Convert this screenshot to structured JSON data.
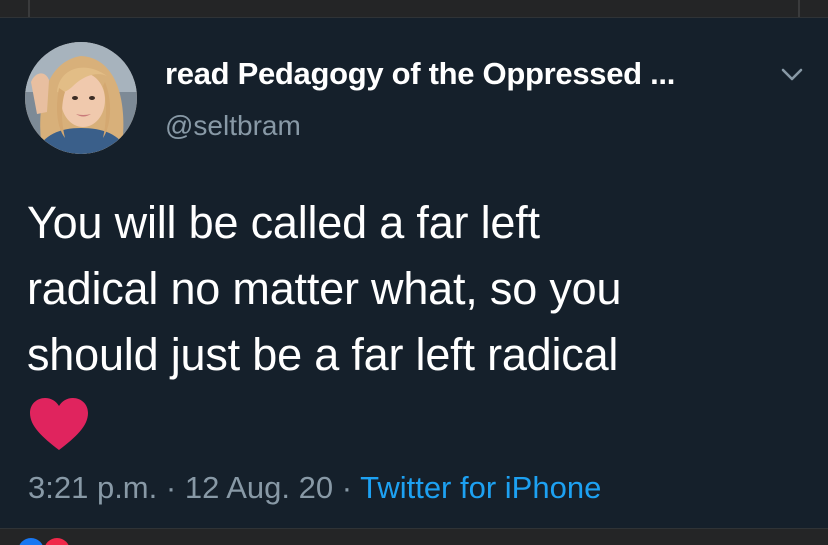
{
  "tweet": {
    "display_name": "read Pedagogy of the Oppressed ...",
    "handle": "@seltbram",
    "text_lines": [
      "You will be called a far left",
      "radical no matter what, so you",
      "should just be a far left radical"
    ],
    "time": "3:21 p.m.",
    "separator": "·",
    "date": "12 Aug. 20",
    "source": "Twitter for iPhone"
  },
  "icons": {
    "menu": "chevron-down-icon",
    "emoji": "red-heart-icon"
  },
  "colors": {
    "background": "#15202b",
    "text": "#ffffff",
    "secondary_text": "#8899a6",
    "link": "#1da1f2",
    "heart": "#e0245e"
  }
}
